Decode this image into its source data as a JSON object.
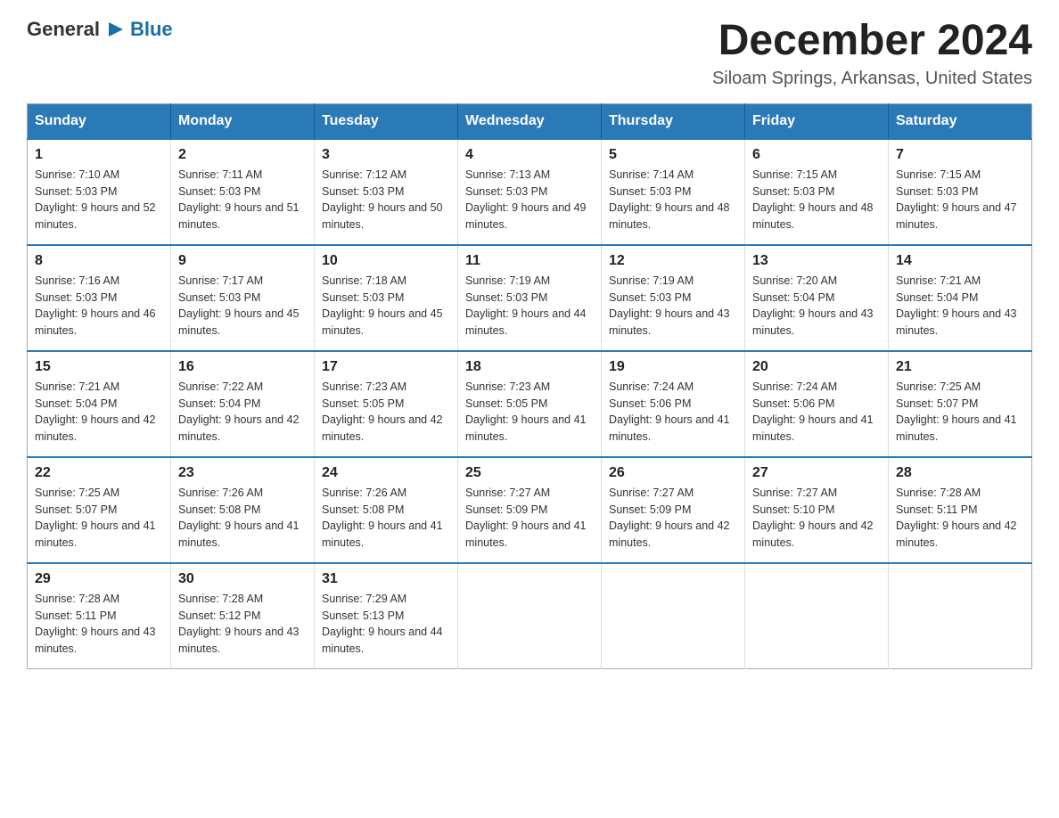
{
  "header": {
    "logo": {
      "general": "General",
      "arrow_icon": "▶",
      "blue": "Blue"
    },
    "title": "December 2024",
    "location": "Siloam Springs, Arkansas, United States"
  },
  "days_of_week": [
    "Sunday",
    "Monday",
    "Tuesday",
    "Wednesday",
    "Thursday",
    "Friday",
    "Saturday"
  ],
  "weeks": [
    [
      {
        "day": "1",
        "sunrise": "7:10 AM",
        "sunset": "5:03 PM",
        "daylight": "9 hours and 52 minutes."
      },
      {
        "day": "2",
        "sunrise": "7:11 AM",
        "sunset": "5:03 PM",
        "daylight": "9 hours and 51 minutes."
      },
      {
        "day": "3",
        "sunrise": "7:12 AM",
        "sunset": "5:03 PM",
        "daylight": "9 hours and 50 minutes."
      },
      {
        "day": "4",
        "sunrise": "7:13 AM",
        "sunset": "5:03 PM",
        "daylight": "9 hours and 49 minutes."
      },
      {
        "day": "5",
        "sunrise": "7:14 AM",
        "sunset": "5:03 PM",
        "daylight": "9 hours and 48 minutes."
      },
      {
        "day": "6",
        "sunrise": "7:15 AM",
        "sunset": "5:03 PM",
        "daylight": "9 hours and 48 minutes."
      },
      {
        "day": "7",
        "sunrise": "7:15 AM",
        "sunset": "5:03 PM",
        "daylight": "9 hours and 47 minutes."
      }
    ],
    [
      {
        "day": "8",
        "sunrise": "7:16 AM",
        "sunset": "5:03 PM",
        "daylight": "9 hours and 46 minutes."
      },
      {
        "day": "9",
        "sunrise": "7:17 AM",
        "sunset": "5:03 PM",
        "daylight": "9 hours and 45 minutes."
      },
      {
        "day": "10",
        "sunrise": "7:18 AM",
        "sunset": "5:03 PM",
        "daylight": "9 hours and 45 minutes."
      },
      {
        "day": "11",
        "sunrise": "7:19 AM",
        "sunset": "5:03 PM",
        "daylight": "9 hours and 44 minutes."
      },
      {
        "day": "12",
        "sunrise": "7:19 AM",
        "sunset": "5:03 PM",
        "daylight": "9 hours and 43 minutes."
      },
      {
        "day": "13",
        "sunrise": "7:20 AM",
        "sunset": "5:04 PM",
        "daylight": "9 hours and 43 minutes."
      },
      {
        "day": "14",
        "sunrise": "7:21 AM",
        "sunset": "5:04 PM",
        "daylight": "9 hours and 43 minutes."
      }
    ],
    [
      {
        "day": "15",
        "sunrise": "7:21 AM",
        "sunset": "5:04 PM",
        "daylight": "9 hours and 42 minutes."
      },
      {
        "day": "16",
        "sunrise": "7:22 AM",
        "sunset": "5:04 PM",
        "daylight": "9 hours and 42 minutes."
      },
      {
        "day": "17",
        "sunrise": "7:23 AM",
        "sunset": "5:05 PM",
        "daylight": "9 hours and 42 minutes."
      },
      {
        "day": "18",
        "sunrise": "7:23 AM",
        "sunset": "5:05 PM",
        "daylight": "9 hours and 41 minutes."
      },
      {
        "day": "19",
        "sunrise": "7:24 AM",
        "sunset": "5:06 PM",
        "daylight": "9 hours and 41 minutes."
      },
      {
        "day": "20",
        "sunrise": "7:24 AM",
        "sunset": "5:06 PM",
        "daylight": "9 hours and 41 minutes."
      },
      {
        "day": "21",
        "sunrise": "7:25 AM",
        "sunset": "5:07 PM",
        "daylight": "9 hours and 41 minutes."
      }
    ],
    [
      {
        "day": "22",
        "sunrise": "7:25 AM",
        "sunset": "5:07 PM",
        "daylight": "9 hours and 41 minutes."
      },
      {
        "day": "23",
        "sunrise": "7:26 AM",
        "sunset": "5:08 PM",
        "daylight": "9 hours and 41 minutes."
      },
      {
        "day": "24",
        "sunrise": "7:26 AM",
        "sunset": "5:08 PM",
        "daylight": "9 hours and 41 minutes."
      },
      {
        "day": "25",
        "sunrise": "7:27 AM",
        "sunset": "5:09 PM",
        "daylight": "9 hours and 41 minutes."
      },
      {
        "day": "26",
        "sunrise": "7:27 AM",
        "sunset": "5:09 PM",
        "daylight": "9 hours and 42 minutes."
      },
      {
        "day": "27",
        "sunrise": "7:27 AM",
        "sunset": "5:10 PM",
        "daylight": "9 hours and 42 minutes."
      },
      {
        "day": "28",
        "sunrise": "7:28 AM",
        "sunset": "5:11 PM",
        "daylight": "9 hours and 42 minutes."
      }
    ],
    [
      {
        "day": "29",
        "sunrise": "7:28 AM",
        "sunset": "5:11 PM",
        "daylight": "9 hours and 43 minutes."
      },
      {
        "day": "30",
        "sunrise": "7:28 AM",
        "sunset": "5:12 PM",
        "daylight": "9 hours and 43 minutes."
      },
      {
        "day": "31",
        "sunrise": "7:29 AM",
        "sunset": "5:13 PM",
        "daylight": "9 hours and 44 minutes."
      },
      null,
      null,
      null,
      null
    ]
  ]
}
